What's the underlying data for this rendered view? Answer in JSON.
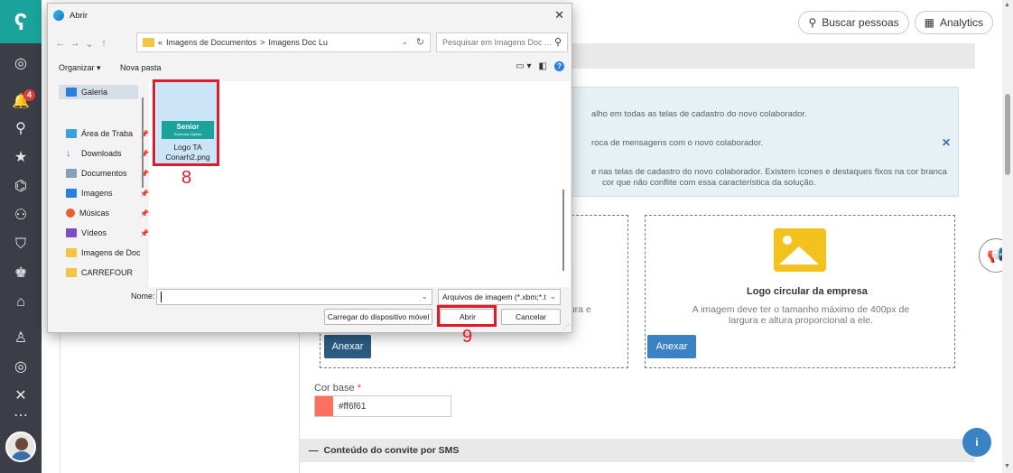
{
  "app": {
    "top_buttons": {
      "search_people": "Buscar pessoas",
      "analytics": "Analytics"
    },
    "notification_count": "4",
    "info_box": {
      "line1": "alho em todas as telas de cadastro do novo colaborador.",
      "line2": "roca de mensagens com o novo colaborador.",
      "line3": "e nas telas de cadastro do novo colaborador. Existem ícones e destaques fixos na cor branca",
      "line4": "cor que não conflite com essa característica da solução."
    },
    "upload_left": {
      "desc_partial": "gura e",
      "button": "Anexar"
    },
    "upload_right": {
      "title": "Logo circular da empresa",
      "desc": "A imagem deve ter o tamanho máximo de 400px de largura e altura proporcional a ele.",
      "button": "Anexar"
    },
    "cor_base": {
      "label": "Cor base",
      "required": "*",
      "value": "#ff6f61",
      "color": "#ff6f61"
    },
    "sms_section": {
      "toggle": "—",
      "title": "Conteúdo do convite por SMS"
    },
    "fab": "i"
  },
  "dialog": {
    "title": "Abrir",
    "breadcrumb": {
      "prefix": "«",
      "part1": "Imagens de Documentos",
      "sep": ">",
      "part2": "Imagens Doc Lu"
    },
    "search_placeholder": "Pesquisar em Imagens Doc ...",
    "toolbar": {
      "organize": "Organizar ▾",
      "new_folder": "Nova pasta"
    },
    "nav_items": [
      {
        "label": "Galeria",
        "icon": "gallery-icon"
      },
      {
        "label": "Área de Traba",
        "icon": "desktop-icon"
      },
      {
        "label": "Downloads",
        "icon": "download-icon"
      },
      {
        "label": "Documentos",
        "icon": "document-icon"
      },
      {
        "label": "Imagens",
        "icon": "pictures-icon"
      },
      {
        "label": "Músicas",
        "icon": "music-icon"
      },
      {
        "label": "Vídeos",
        "icon": "video-icon"
      },
      {
        "label": "Imagens de Doc",
        "icon": "folder-icon"
      },
      {
        "label": "CARREFOUR",
        "icon": "folder-icon"
      }
    ],
    "file": {
      "name": "Logo TA Conarh2.png",
      "thumb_brand": "Senior",
      "thumb_tag": "Sistemas Digitais"
    },
    "name_label": "Nome:",
    "name_value": "",
    "file_type": "Arquivos de imagem (*.xbm;*.t",
    "buttons": {
      "upload_device": "Carregar do dispositivo móvel",
      "open": "Abrir",
      "cancel": "Cancelar"
    }
  },
  "annotations": {
    "step_file": "8",
    "step_open": "9",
    "color": "#e0192b"
  }
}
